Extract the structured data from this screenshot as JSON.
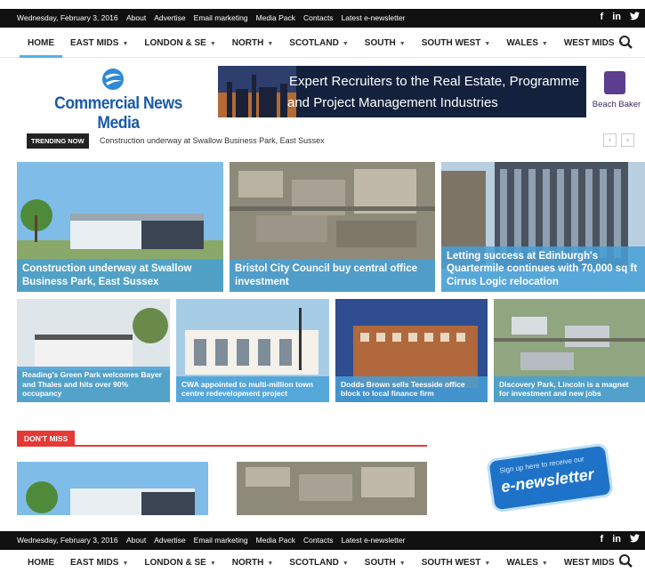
{
  "topbar": {
    "date": "Wednesday, February 3, 2016",
    "links": [
      "About",
      "Advertise",
      "Email marketing",
      "Media Pack",
      "Contacts",
      "Latest e-newsletter"
    ],
    "social": [
      "f",
      "in",
      "twitter-icon"
    ]
  },
  "nav": {
    "items": [
      {
        "label": "HOME",
        "dropdown": false,
        "active": true
      },
      {
        "label": "EAST MIDS",
        "dropdown": true
      },
      {
        "label": "LONDON & SE",
        "dropdown": true
      },
      {
        "label": "NORTH",
        "dropdown": true
      },
      {
        "label": "SCOTLAND",
        "dropdown": true
      },
      {
        "label": "SOUTH",
        "dropdown": true
      },
      {
        "label": "SOUTH WEST",
        "dropdown": true
      },
      {
        "label": "WALES",
        "dropdown": true
      },
      {
        "label": "WEST MIDS",
        "dropdown": true
      }
    ],
    "search_icon": "search-icon"
  },
  "logo": {
    "text": "Commercial News Media"
  },
  "banner": {
    "line1": "Expert Recruiters to the Real Estate, Programme",
    "line2": "and Project Management Industries",
    "brand": "Beach Baker"
  },
  "trending": {
    "label": "TRENDING NOW",
    "headline": "Construction underway at Swallow Business Park, East Sussex",
    "prev": "‹",
    "next": "›"
  },
  "featured": {
    "big": [
      "Construction underway at Swallow Business Park, East Sussex",
      "Bristol City Council buy central office investment",
      "Letting success at Edinburgh's Quartermile continues with 70,000 sq ft Cirrus Logic relocation"
    ],
    "small": [
      "Reading's Green Park welcomes Bayer and Thales and hits over 90% occupancy",
      "CWA appointed to multi-million town centre redevelopment project",
      "Dodds Brown sells Teesside office block to local finance firm",
      "Discovery Park, Lincoln is a magnet for investment and new jobs"
    ]
  },
  "dont_miss": {
    "label": "DON'T MISS"
  },
  "newsletter": {
    "line1": "Sign up here to receive our",
    "line2": "e-newsletter"
  },
  "colors": {
    "accent": "#4db2ec",
    "red": "#e53935",
    "logo_blue": "#1a5aa8"
  }
}
